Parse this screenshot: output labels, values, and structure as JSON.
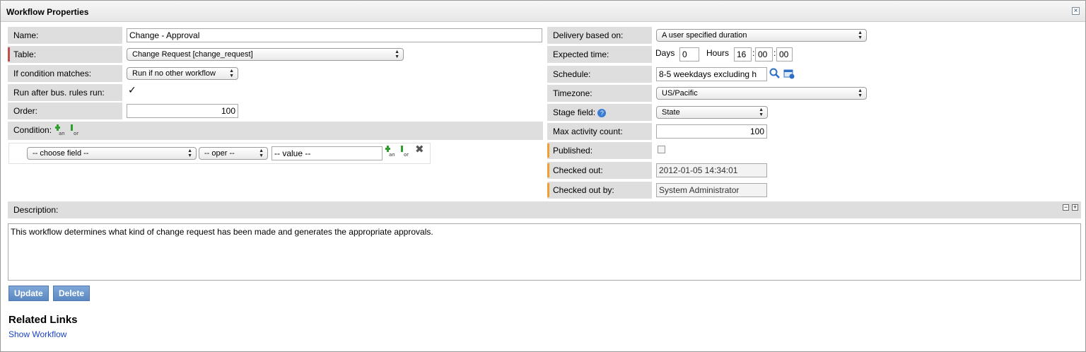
{
  "window": {
    "title": "Workflow Properties",
    "close_label": "×"
  },
  "left": {
    "name": {
      "label": "Name:",
      "value": "Change - Approval"
    },
    "table": {
      "label": "Table:",
      "value": "Change Request [change_request]"
    },
    "if_condition": {
      "label": "If condition matches:",
      "value": "Run if no other workflow"
    },
    "run_after": {
      "label": "Run after bus. rules run:",
      "checked": "✓"
    },
    "order": {
      "label": "Order:",
      "value": "100"
    },
    "condition": {
      "label": "Condition:",
      "and_label": "and",
      "or_label": "or",
      "field_placeholder": "-- choose field --",
      "oper_placeholder": "-- oper --",
      "value_placeholder": "-- value --"
    }
  },
  "right": {
    "delivery": {
      "label": "Delivery based on:",
      "value": "A user specified duration"
    },
    "expected": {
      "label": "Expected time:",
      "days_label": "Days",
      "days": "0",
      "hours_label": "Hours",
      "hh": "16",
      "mm": "00",
      "ss": "00"
    },
    "schedule": {
      "label": "Schedule:",
      "value": "8-5 weekdays excluding h"
    },
    "timezone": {
      "label": "Timezone:",
      "value": "US/Pacific"
    },
    "stage_field": {
      "label": "Stage field:",
      "value": "State"
    },
    "max_activity": {
      "label": "Max activity count:",
      "value": "100"
    },
    "published": {
      "label": "Published:"
    },
    "checked_out": {
      "label": "Checked out:",
      "value": "2012-01-05 14:34:01"
    },
    "checked_out_by": {
      "label": "Checked out by:",
      "value": "System Administrator"
    }
  },
  "description": {
    "label": "Description:",
    "text": "This workflow determines what kind of change request has been made and generates the appropriate approvals."
  },
  "buttons": {
    "update": "Update",
    "delete": "Delete"
  },
  "related": {
    "title": "Related Links",
    "show_workflow": "Show Workflow"
  },
  "colors": {
    "mandatory": "#c0504d",
    "readonly_marker": "#f0a030",
    "button": "#6a96cd",
    "link": "#1a44c7"
  }
}
